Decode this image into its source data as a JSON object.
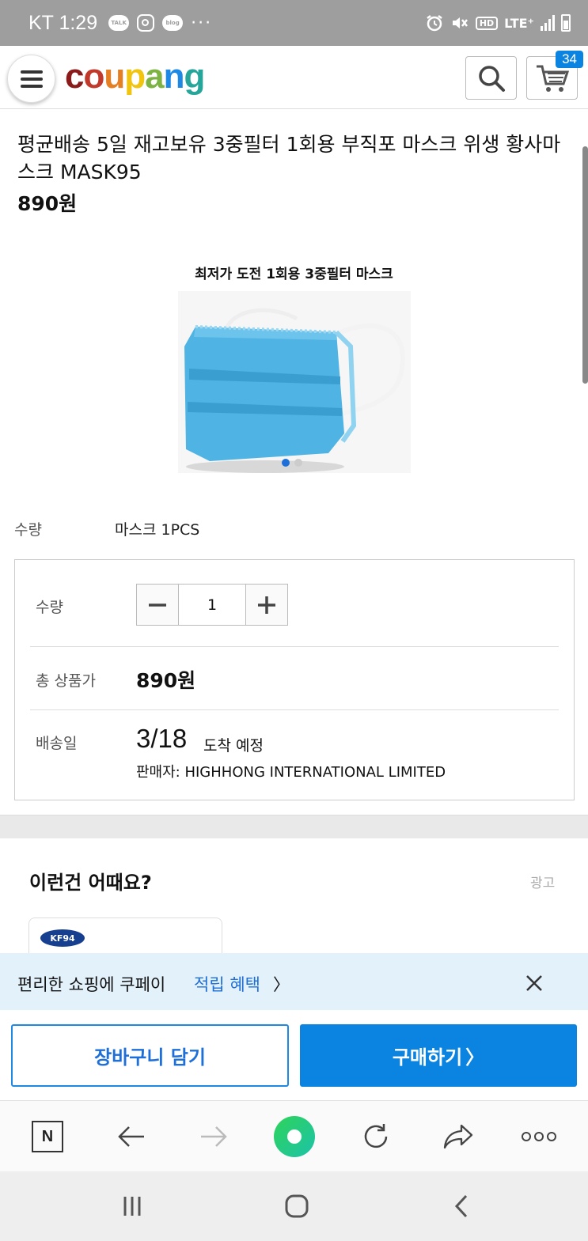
{
  "status_bar": {
    "carrier_time": "KT 1:29",
    "talk_badge": "TALK",
    "blog_badge": "blog",
    "more": "···",
    "hd": "HD",
    "network": "LTE⁺"
  },
  "header": {
    "logo": [
      "c",
      "o",
      "u",
      "p",
      "a",
      "n",
      "g"
    ],
    "cart_count": "34"
  },
  "product": {
    "title": "평균배송 5일 재고보유 3중필터 1회용 부직포 마스크 위생 황사마스크 MASK95",
    "price": "890원",
    "image_caption": "최저가 도전 1회용 3중필터 마스크"
  },
  "option": {
    "label": "수량",
    "value": "마스크 1PCS"
  },
  "order": {
    "qty_label": "수량",
    "qty_value": "1",
    "total_label": "총 상품가",
    "total_value": "890원",
    "delivery_label": "배송일",
    "delivery_date": "3/18",
    "delivery_suffix": "도착 예정",
    "seller": "판매자: HIGHHONG INTERNATIONAL LIMITED"
  },
  "recommend": {
    "title": "이런건 어때요?",
    "ad_label": "광고",
    "card_badge": "KF94"
  },
  "promo": {
    "text": "편리한 쇼핑에 쿠페이",
    "accent": "적립 혜택",
    "chevron": "〉"
  },
  "actions": {
    "add_to_cart": "장바구니 담기",
    "buy_now": "구매하기",
    "buy_chevron": "〉"
  },
  "browser": {
    "n_label": "N"
  },
  "colors": {
    "accent": "#0a84e0",
    "promo_bg": "#e3f1fb"
  }
}
